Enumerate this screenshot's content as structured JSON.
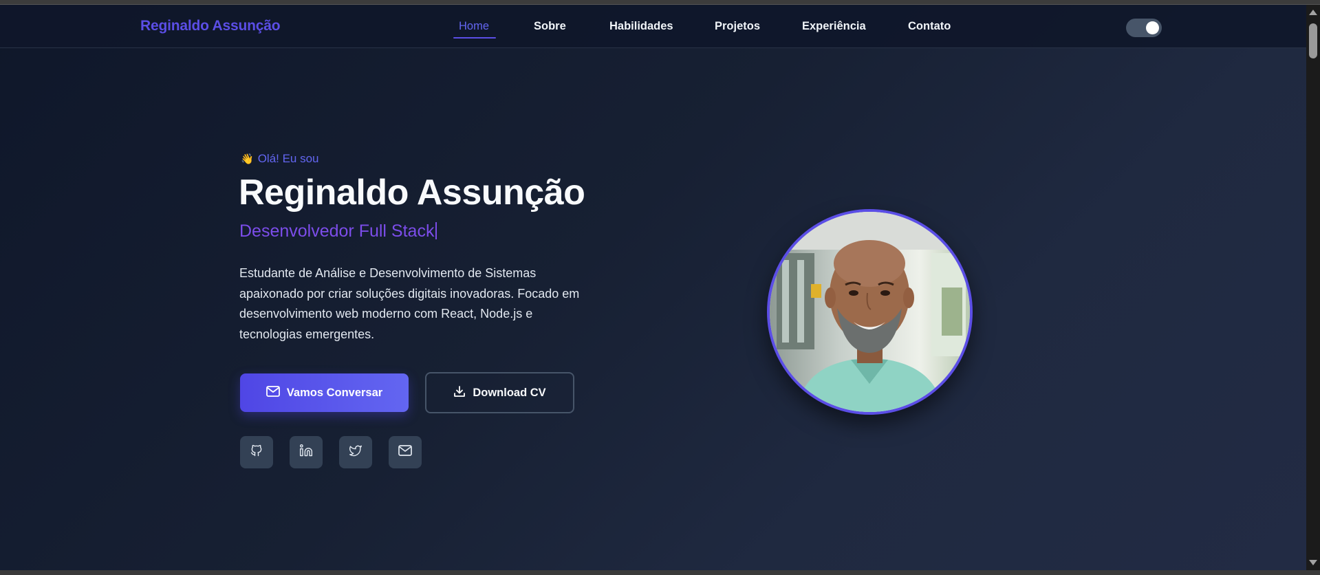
{
  "navbar": {
    "brand": "Reginaldo Assunção",
    "links": [
      {
        "label": "Home",
        "active": true
      },
      {
        "label": "Sobre",
        "active": false
      },
      {
        "label": "Habilidades",
        "active": false
      },
      {
        "label": "Projetos",
        "active": false
      },
      {
        "label": "Experiência",
        "active": false
      },
      {
        "label": "Contato",
        "active": false
      }
    ],
    "theme_toggle_on": true
  },
  "hero": {
    "greeting_emoji": "👋",
    "greeting": "Olá! Eu sou",
    "name": "Reginaldo Assunção",
    "role": "Desenvolvedor Full Stack",
    "description": "Estudante de Análise e Desenvolvimento de Sistemas apaixonado por criar soluções digitais inovadoras. Focado em desenvolvimento web moderno com React, Node.js e tecnologias emergentes.",
    "primary_button": {
      "label": "Vamos Conversar",
      "icon": "mail-icon"
    },
    "secondary_button": {
      "label": "Download CV",
      "icon": "download-icon"
    },
    "social_links": [
      {
        "icon": "github-icon"
      },
      {
        "icon": "linkedin-icon"
      },
      {
        "icon": "twitter-icon"
      },
      {
        "icon": "mail-icon"
      }
    ],
    "profile_photo": "profile-photo"
  },
  "colors": {
    "accent": "#5b4ee6",
    "role": "#7c4dea",
    "background": "#0f172a"
  }
}
